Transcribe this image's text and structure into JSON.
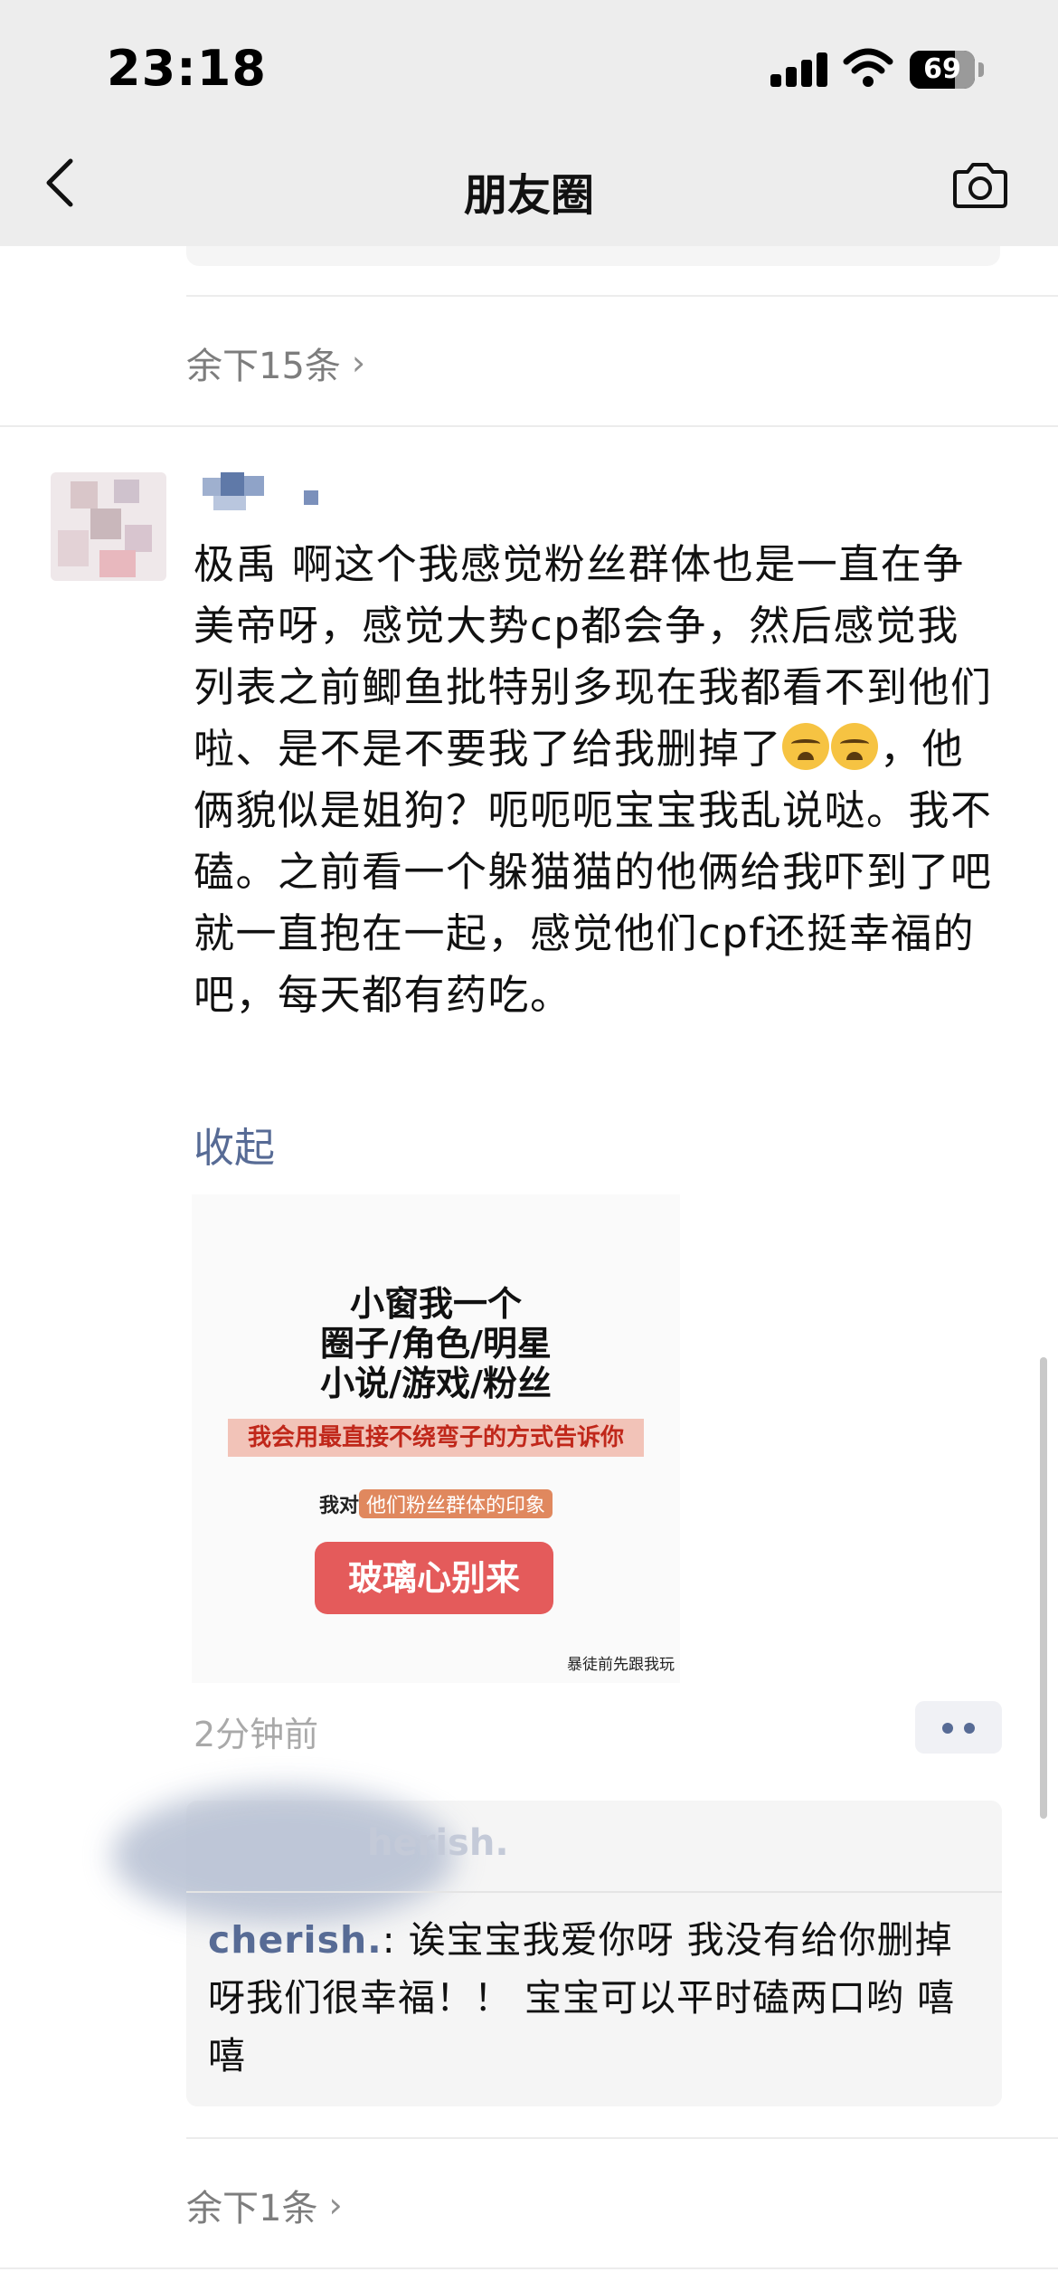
{
  "status_bar": {
    "time": "23:18",
    "battery_percent": "69",
    "battery_level": 0.69
  },
  "nav": {
    "title": "朋友圈",
    "back_icon": "chevron-left-icon",
    "camera_icon": "camera-icon"
  },
  "feed": {
    "previous_post": {
      "more_comments": "余下15条",
      "more_chevron": "›"
    },
    "post": {
      "text_part1": "极禹 啊这个我感觉粉丝群体也是一直在争美帝呀，感觉大势cp都会争，然后感觉我列表之前鲫鱼批特别多现在我都看不到他们啦、是不是不要我了给我删掉了",
      "emoji_name": "crying-face",
      "text_part2": "，他俩貌似是姐狗？呃呃呃宝宝我乱说哒。我不磕。之前看一个躲猫猫的他俩给我吓到了吧就一直抱在一起，感觉他们cpf还挺幸福的吧，每天都有药吃。",
      "collapse_label": "收起",
      "image": {
        "title_lines": [
          "小窗我一个",
          "圈子/角色/明星",
          "小说/游戏/粉丝"
        ],
        "banner": "我会用最直接不绕弯子的方式告诉你",
        "row_prefix": "我对",
        "row_tag": "他们粉丝群体的印象",
        "pill": "玻璃心别来",
        "caption": "暴徒前先跟我玩"
      },
      "timestamp": "2分钟前",
      "likes_visible_name": "herish.",
      "comment": {
        "author": "cherish.",
        "separator": ": ",
        "text": "诶宝宝我爱你呀 我没有给你删掉呀我们很幸福！！ 宝宝可以平时磕两口哟 嘻嘻"
      },
      "more_comments": "余下1条",
      "more_chevron": "›"
    }
  },
  "colors": {
    "link_blue": "#576b95",
    "header_bg": "#ededed",
    "meta_gray": "#a9a9a9"
  }
}
